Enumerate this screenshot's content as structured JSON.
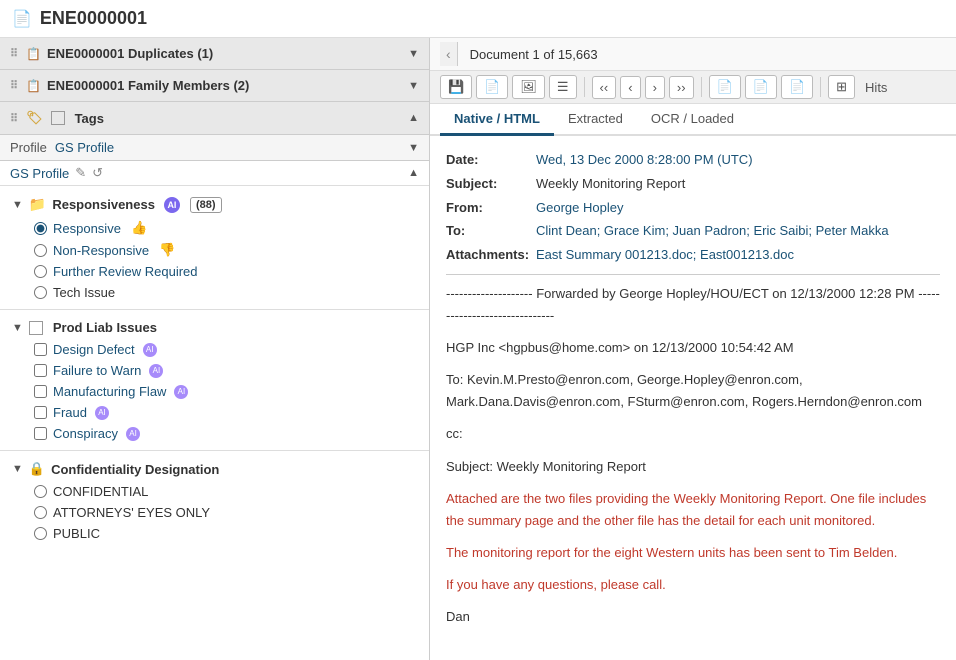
{
  "header": {
    "icon": "📄",
    "title": "ENE0000001"
  },
  "leftPanel": {
    "groups": [
      {
        "id": "duplicates",
        "label": "ENE0000001 Duplicates (1)",
        "icon": "📋",
        "collapsed": false
      },
      {
        "id": "family",
        "label": "ENE0000001 Family Members (2)",
        "icon": "📋",
        "collapsed": false
      }
    ],
    "tags": {
      "label": "Tags"
    },
    "profile": {
      "label": "Profile",
      "name": "GS Profile"
    },
    "gsProfile": {
      "label": "GS Profile"
    },
    "responsiveness": {
      "label": "Responsiveness",
      "count": "(88)",
      "items": [
        {
          "id": "responsive",
          "label": "Responsive",
          "checked": true
        },
        {
          "id": "non-responsive",
          "label": "Non-Responsive",
          "checked": false
        },
        {
          "id": "further-review",
          "label": "Further Review Required",
          "checked": false
        },
        {
          "id": "tech-issue",
          "label": "Tech Issue",
          "checked": false
        }
      ]
    },
    "prodLiab": {
      "label": "Prod Liab Issues",
      "items": [
        {
          "id": "design-defect",
          "label": "Design Defect",
          "hasAi": true
        },
        {
          "id": "failure-to-warn",
          "label": "Failure to Warn",
          "hasAi": true
        },
        {
          "id": "manufacturing-flaw",
          "label": "Manufacturing Flaw",
          "hasAi": true
        },
        {
          "id": "fraud",
          "label": "Fraud",
          "hasAi": true
        },
        {
          "id": "conspiracy",
          "label": "Conspiracy",
          "hasAi": true
        }
      ]
    },
    "confidentiality": {
      "label": "Confidentiality Designation",
      "items": [
        {
          "id": "confidential",
          "label": "CONFIDENTIAL"
        },
        {
          "id": "attorneys-eyes",
          "label": "ATTORNEYS' EYES ONLY"
        },
        {
          "id": "public",
          "label": "PUBLIC"
        }
      ]
    }
  },
  "rightPanel": {
    "docCount": "Document 1 of 15,663",
    "tabs": [
      {
        "id": "native-html",
        "label": "Native / HTML",
        "active": true
      },
      {
        "id": "extracted",
        "label": "Extracted",
        "active": false
      },
      {
        "id": "ocr-loaded",
        "label": "OCR / Loaded",
        "active": false
      }
    ],
    "hitsLabel": "Hits",
    "document": {
      "date_label": "Date:",
      "date_value": "Wed, 13 Dec 2000 8:28:00 PM (UTC)",
      "subject_label": "Subject:",
      "subject_value": "Weekly Monitoring Report",
      "from_label": "From:",
      "from_value": "George Hopley",
      "to_label": "To:",
      "to_value": "Clint Dean; Grace Kim; Juan Padron; Eric Saibi; Peter Makka",
      "attachments_label": "Attachments:",
      "attachments_value": "East Summary 001213.doc; East001213.doc",
      "forwarded_text": "-------------------- Forwarded by George Hopley/HOU/ECT on 12/13/2000 12:28 PM ------------------------------",
      "body_line1": "HGP Inc <hgpbus@home.com> on 12/13/2000 10:54:42 AM",
      "body_to": "To: Kevin.M.Presto@enron.com, George.Hopley@enron.com,",
      "body_to2": "Mark.Dana.Davis@enron.com, FSturm@enron.com, Rogers.Herndon@enron.com",
      "body_cc": "cc:",
      "body_subject": "Subject: Weekly Monitoring Report",
      "body_p1": "Attached are the two files providing the Weekly Monitoring Report.  One file includes the summary page and the other file has the detail for each unit monitored.",
      "body_p2": "The monitoring report for the eight Western units has been sent to Tim Belden.",
      "body_p3": "If you have any questions, please call.",
      "body_sign": "Dan"
    }
  }
}
